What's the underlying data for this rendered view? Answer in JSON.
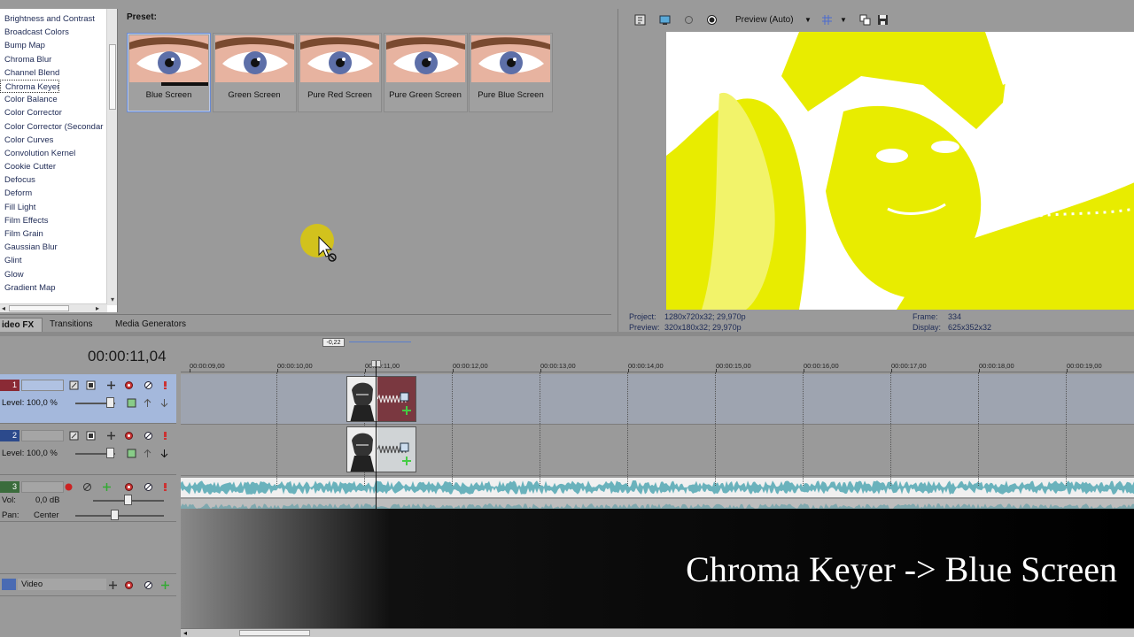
{
  "fx_list": {
    "items": [
      "Brightness and Contrast",
      "Broadcast Colors",
      "Bump Map",
      "Chroma Blur",
      "Channel Blend",
      "Chroma Keyer",
      "Color Balance",
      "Color Corrector",
      "Color Corrector (Secondar",
      "Color Curves",
      "Convolution Kernel",
      "Cookie Cutter",
      "Defocus",
      "Deform",
      "Fill Light",
      "Film Effects",
      "Film Grain",
      "Gaussian Blur",
      "Glint",
      "Glow",
      "Gradient Map"
    ],
    "selected": "Chroma Keyer"
  },
  "presets": {
    "label": "Preset:",
    "items": [
      "Blue Screen",
      "Green Screen",
      "Pure Red Screen",
      "Pure Green Screen",
      "Pure Blue Screen"
    ],
    "selected": "Blue Screen"
  },
  "preview": {
    "mode": "Preview (Auto)",
    "project_label": "Project:",
    "project_value": "1280x720x32; 29,970p",
    "preview_label": "Preview:",
    "preview_value": "320x180x32; 29,970p",
    "frame_label": "Frame:",
    "frame_value": "334",
    "display_label": "Display:",
    "display_value": "625x352x32"
  },
  "tabs": [
    "ideo FX",
    "Transitions",
    "Media Generators"
  ],
  "timeline": {
    "timecode": "00:00:11,04",
    "marker": "-0,22",
    "ruler": [
      "00:00:09,00",
      "00:00:10,00",
      "00:00:11,00",
      "00:00:12,00",
      "00:00:13,00",
      "00:00:14,00",
      "00:00:15,00",
      "00:00:16,00",
      "00:00:17,00",
      "00:00:18,00",
      "00:00:19,00"
    ],
    "tracks": [
      {
        "num": "1",
        "level": "Level: 100,0 %"
      },
      {
        "num": "2",
        "level": "Level: 100,0 %"
      },
      {
        "num": "3",
        "vol_label": "Vol:",
        "vol_value": "0,0 dB",
        "pan_label": "Pan:",
        "pan_value": "Center"
      },
      {
        "num": "",
        "name": "Video"
      }
    ]
  },
  "caption": "Chroma Keyer -> Blue Screen",
  "colors": {
    "preview_tint": "#e8ec00",
    "track1": "#8a2a35",
    "track2": "#2c4a8c",
    "track3": "#3b6c3c",
    "selected_track_bg": "#a4b8dc",
    "audio_wave": "#6ab2bc"
  }
}
